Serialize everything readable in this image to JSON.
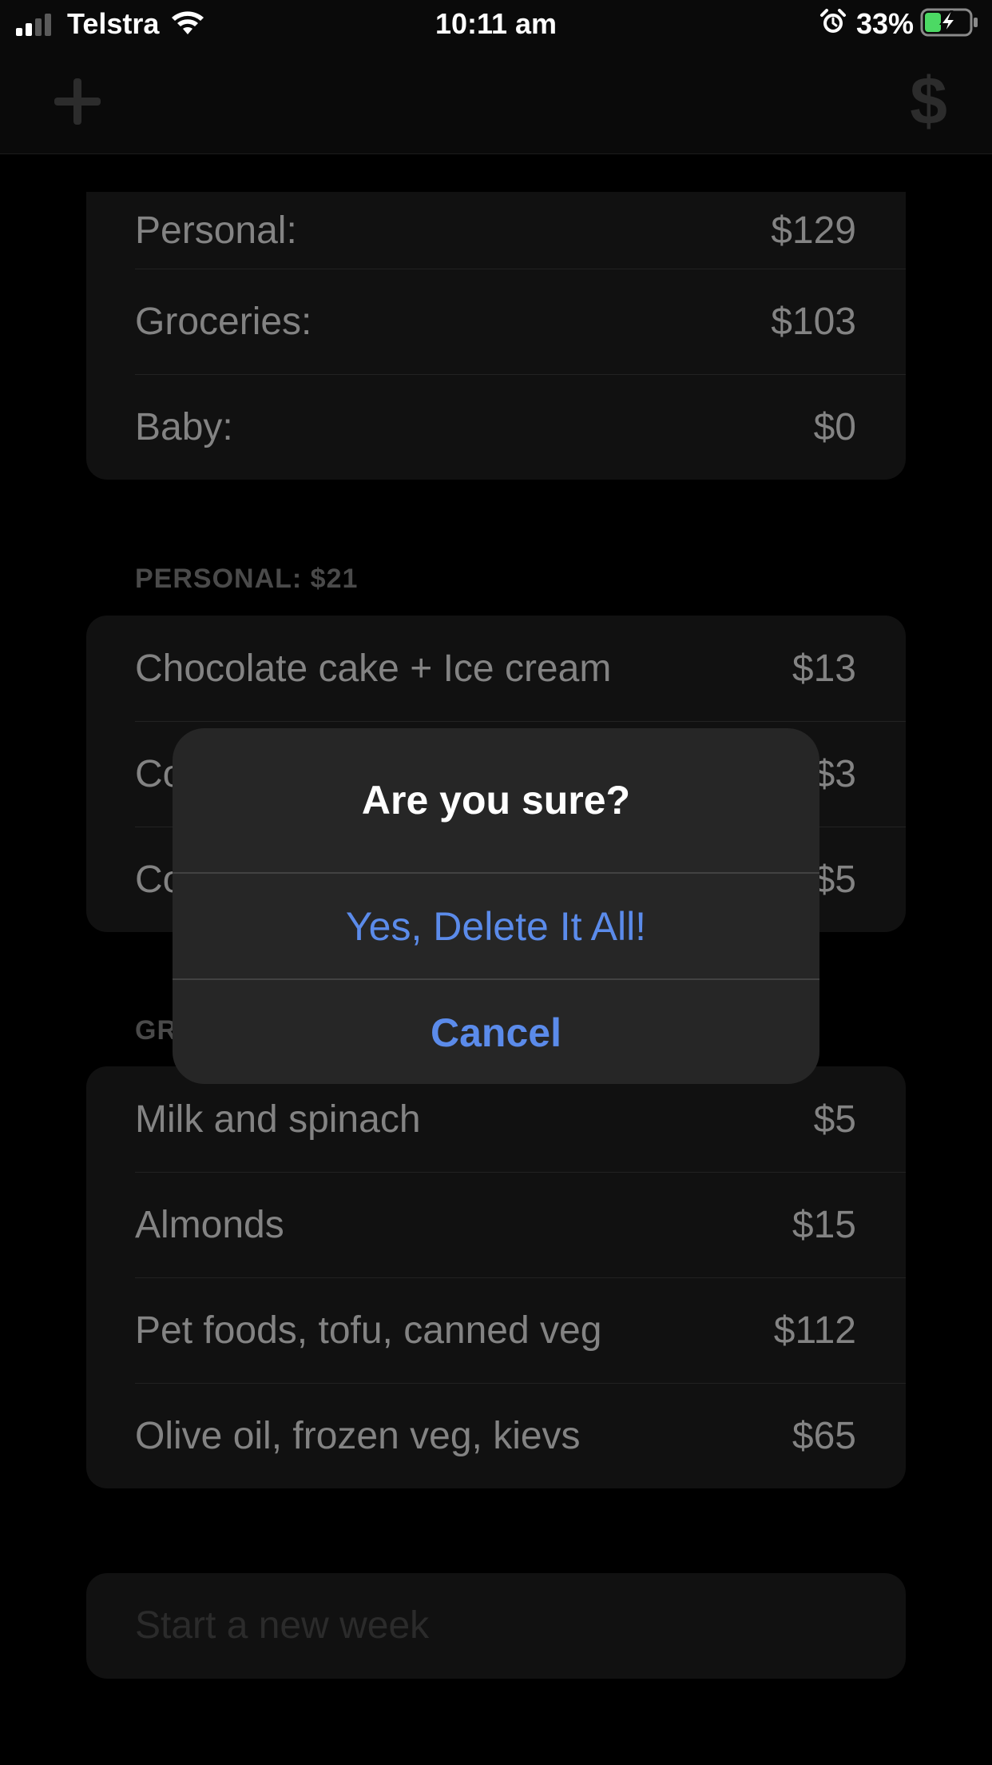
{
  "status_bar": {
    "carrier": "Telstra",
    "time": "10:11 am",
    "battery_percent": "33%",
    "signal_bars_active": 2,
    "signal_bars_total": 4,
    "wifi_icon": "wifi-icon",
    "alarm_icon": "alarm-icon",
    "battery_icon": "battery-charging-icon",
    "battery_color": "#4cd964"
  },
  "nav_bar": {
    "add_icon": "plus-icon",
    "dollar_label": "$"
  },
  "summary": {
    "rows": [
      {
        "label": "Personal:",
        "value": "$129"
      },
      {
        "label": "Groceries:",
        "value": "$103"
      },
      {
        "label": "Baby:",
        "value": "$0"
      }
    ]
  },
  "personal_section": {
    "header": "PERSONAL: $21",
    "rows": [
      {
        "label": "Chocolate cake + Ice cream",
        "value": "$13"
      },
      {
        "label": "Co",
        "value": "$3"
      },
      {
        "label": "Co",
        "value": "$5"
      }
    ]
  },
  "groceries_section": {
    "header": "GR",
    "rows": [
      {
        "label": "Milk and spinach",
        "value": "$5"
      },
      {
        "label": "Almonds",
        "value": "$15"
      },
      {
        "label": "Pet foods, tofu, canned veg",
        "value": "$112"
      },
      {
        "label": "Olive oil, frozen veg, kievs",
        "value": "$65"
      }
    ]
  },
  "new_week": {
    "label": "Start a new week"
  },
  "alert": {
    "title": "Are you sure?",
    "confirm_label": "Yes, Delete It All!",
    "cancel_label": "Cancel",
    "accent_color": "#5b8bea"
  }
}
